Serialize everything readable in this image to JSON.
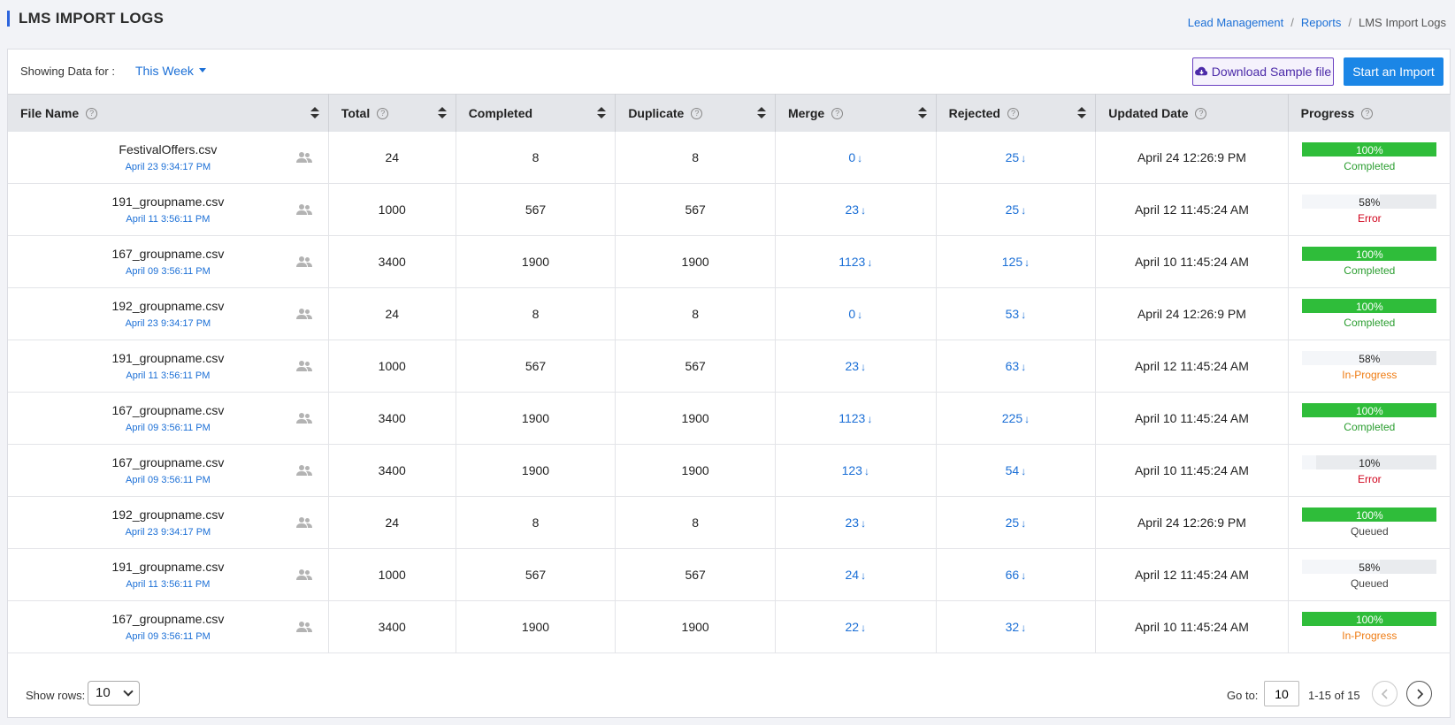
{
  "header": {
    "title": "LMS IMPORT LOGS",
    "breadcrumb": [
      {
        "label": "Lead Management"
      },
      {
        "label": "Reports"
      },
      {
        "label": "LMS Import Logs"
      }
    ],
    "breadcrumb_separator": "/"
  },
  "toolbar": {
    "showing_label": "Showing Data for :",
    "period_value": "This Week",
    "download_label": "Download Sample file",
    "import_label": "Start an Import"
  },
  "table": {
    "columns": [
      {
        "label": "File Name",
        "help": true,
        "sort": true
      },
      {
        "label": "Total",
        "help": true,
        "sort": true
      },
      {
        "label": "Completed",
        "help": false,
        "sort": true
      },
      {
        "label": "Duplicate",
        "help": true,
        "sort": true
      },
      {
        "label": "Merge",
        "help": true,
        "sort": true
      },
      {
        "label": "Rejected",
        "help": true,
        "sort": true
      },
      {
        "label": "Updated Date",
        "help": true,
        "sort": false
      },
      {
        "label": "Progress",
        "help": true,
        "sort": false
      }
    ],
    "help_glyph": "?",
    "arrow_glyph": "↓",
    "rows": [
      {
        "file": "FestivalOffers.csv",
        "date": "April 23 9:34:17 PM",
        "total": "24",
        "completed": "8",
        "duplicate": "8",
        "merge": "0",
        "rejected": "25",
        "updated": "April 24 12:26:9 PM",
        "progress": 1.0,
        "progress_label": "100%",
        "status": "Completed"
      },
      {
        "file": "191_groupname.csv",
        "date": "April 11 3:56:11 PM",
        "total": "1000",
        "completed": "567",
        "duplicate": "567",
        "merge": "23",
        "rejected": "25",
        "updated": "April 12 11:45:24 AM",
        "progress": 0.58,
        "progress_label": "58%",
        "status": "Error"
      },
      {
        "file": "167_groupname.csv",
        "date": "April 09 3:56:11 PM",
        "total": "3400",
        "completed": "1900",
        "duplicate": "1900",
        "merge": "1123",
        "rejected": "125",
        "updated": "April 10 11:45:24 AM",
        "progress": 1.0,
        "progress_label": "100%",
        "status": "Completed"
      },
      {
        "file": "192_groupname.csv",
        "date": "April 23 9:34:17 PM",
        "total": "24",
        "completed": "8",
        "duplicate": "8",
        "merge": "0",
        "rejected": "53",
        "updated": "April 24 12:26:9 PM",
        "progress": 1.0,
        "progress_label": "100%",
        "status": "Completed"
      },
      {
        "file": "191_groupname.csv",
        "date": "April 11 3:56:11 PM",
        "total": "1000",
        "completed": "567",
        "duplicate": "567",
        "merge": "23",
        "rejected": "63",
        "updated": "April 12 11:45:24 AM",
        "progress": 0.58,
        "progress_label": "58%",
        "status": "In-Progress"
      },
      {
        "file": "167_groupname.csv",
        "date": "April 09 3:56:11 PM",
        "total": "3400",
        "completed": "1900",
        "duplicate": "1900",
        "merge": "1123",
        "rejected": "225",
        "updated": "April 10 11:45:24 AM",
        "progress": 1.0,
        "progress_label": "100%",
        "status": "Completed"
      },
      {
        "file": "167_groupname.csv",
        "date": "April 09 3:56:11 PM",
        "total": "3400",
        "completed": "1900",
        "duplicate": "1900",
        "merge": "123",
        "rejected": "54",
        "updated": "April 10 11:45:24 AM",
        "progress": 0.1,
        "progress_label": "10%",
        "status": "Error"
      },
      {
        "file": "192_groupname.csv",
        "date": "April 23 9:34:17 PM",
        "total": "24",
        "completed": "8",
        "duplicate": "8",
        "merge": "23",
        "rejected": "25",
        "updated": "April 24 12:26:9 PM",
        "progress": 1.0,
        "progress_label": "100%",
        "status": "Queued"
      },
      {
        "file": "191_groupname.csv",
        "date": "April 11 3:56:11 PM",
        "total": "1000",
        "completed": "567",
        "duplicate": "567",
        "merge": "24",
        "rejected": "66",
        "updated": "April 12 11:45:24 AM",
        "progress": 0.58,
        "progress_label": "58%",
        "status": "Queued"
      },
      {
        "file": "167_groupname.csv",
        "date": "April 09 3:56:11 PM",
        "total": "3400",
        "completed": "1900",
        "duplicate": "1900",
        "merge": "22",
        "rejected": "32",
        "updated": "April 10 11:45:24 AM",
        "progress": 1.0,
        "progress_label": "100%",
        "status": "In-Progress"
      }
    ]
  },
  "footer": {
    "show_rows_label": "Show rows:",
    "rows_value": "10",
    "goto_label": "Go to:",
    "goto_value": "10",
    "range_text": "1-15 of 15"
  },
  "colors": {
    "accent": "#1b6fd6",
    "primary_button": "#1b86e6",
    "progress_complete": "#2fbd3a",
    "progress_partial": "#f4f6f9",
    "status_completed": "#2a9d2f",
    "status_error": "#d0021b",
    "status_in_progress": "#ef7b12",
    "status_queued": "#444444"
  },
  "icons": {
    "file_row_icon": "group-people-icon",
    "download_icon": "cloud-download-icon",
    "prev_icon": "chevron-left-icon",
    "next_icon": "chevron-right-icon"
  }
}
